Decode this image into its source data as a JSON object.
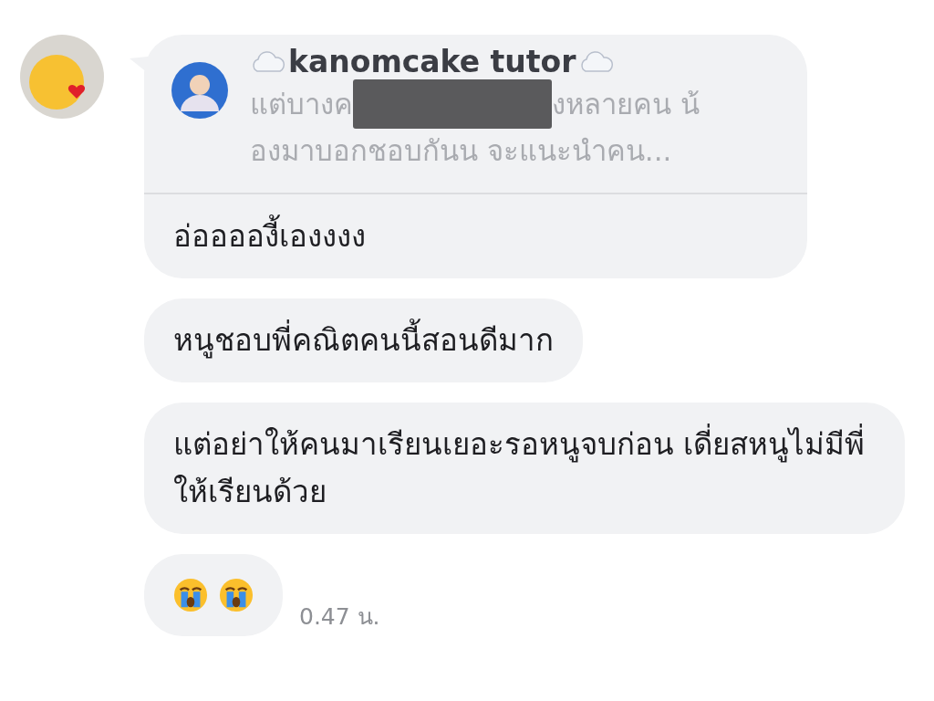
{
  "messages": [
    {
      "kind": "reply",
      "quote": {
        "author": "kanomcake tutor",
        "lines": [
          [
            "แต่บางค",
            "งหลายคน น้"
          ],
          [
            "องมาบอกชอบกันน จะแนะนำคน..."
          ]
        ]
      },
      "text": "อ่อออองี้เองงงง"
    },
    {
      "kind": "text",
      "text": "หนูชอบพี่คณิตคนนี้สอนดีมาก"
    },
    {
      "kind": "text",
      "text": "แต่อย่าให้คนมาเรียนเยอะรอหนูจบก่อน เดี่ยสหนูไม่มีพี่ให้เรียนด้วย"
    },
    {
      "kind": "emoji",
      "emojis": [
        {
          "kind": "crying-face"
        },
        {
          "kind": "crying-face"
        }
      ],
      "time": "0.47 น."
    }
  ]
}
